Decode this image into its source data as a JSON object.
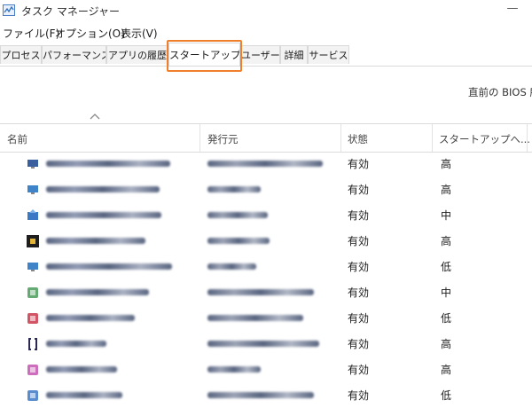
{
  "window": {
    "title": "タスク マネージャー"
  },
  "menu": [
    {
      "label": "ファイル(F)"
    },
    {
      "label": "オプション(O)"
    },
    {
      "label": "表示(V)"
    }
  ],
  "tabs": [
    {
      "label": "プロセス"
    },
    {
      "label": "パフォーマンス"
    },
    {
      "label": "アプリの履歴"
    },
    {
      "label": "スタートアップ",
      "active": true
    },
    {
      "label": "ユーザー"
    },
    {
      "label": "詳細"
    },
    {
      "label": "サービス"
    }
  ],
  "bios_text": "直前の BIOS 所",
  "columns": [
    {
      "label": "名前"
    },
    {
      "label": "発行元"
    },
    {
      "label": "状態"
    },
    {
      "label": "スタートアップへ..."
    }
  ],
  "rows": [
    {
      "status": "有効",
      "impact": "高",
      "icon": "monitor-icon",
      "icon_color": "#3a5f9f"
    },
    {
      "status": "有効",
      "impact": "高",
      "icon": "monitor-icon",
      "icon_color": "#3f84c9"
    },
    {
      "status": "有効",
      "impact": "中",
      "icon": "installer-icon",
      "icon_color": "#3c79c4"
    },
    {
      "status": "有効",
      "impact": "高",
      "icon": "dark-box-icon",
      "icon_color": "#1e1e1e"
    },
    {
      "status": "有効",
      "impact": "低",
      "icon": "monitor-icon",
      "icon_color": "#3f84c9"
    },
    {
      "status": "有効",
      "impact": "中",
      "icon": "app-icon",
      "icon_color": "#4a9a5a"
    },
    {
      "status": "有効",
      "impact": "低",
      "icon": "app-icon",
      "icon_color": "#c9374a"
    },
    {
      "status": "有効",
      "impact": "高",
      "icon": "bracket-icon",
      "icon_color": "#2a2a55"
    },
    {
      "status": "有効",
      "impact": "高",
      "icon": "app-icon",
      "icon_color": "#c455b0"
    },
    {
      "status": "有効",
      "impact": "低",
      "icon": "app-icon",
      "icon_color": "#3c79c4"
    }
  ],
  "colors": {
    "highlight": "#f07f2b",
    "active_tab": "#ffffff",
    "tab_bg": "#f3f3f3"
  }
}
